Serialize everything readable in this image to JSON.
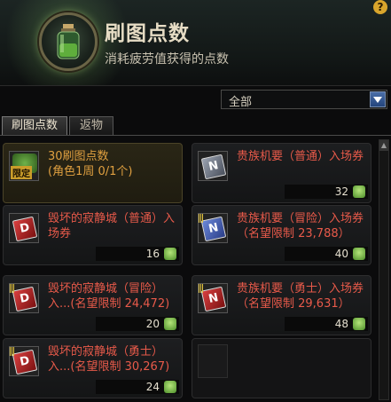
{
  "header": {
    "title": "刷图点数",
    "subtitle": "消耗疲劳值获得的点数",
    "help": "?"
  },
  "filter": {
    "value": "全部"
  },
  "tabs": [
    {
      "label": "刷图点数",
      "active": true
    },
    {
      "label": "返物",
      "active": false
    }
  ],
  "items": [
    {
      "name": "30刷图点数\n(角色1周 0/1个)",
      "badge": "限定",
      "qty": ""
    },
    {
      "name": "贵族机要（普通）入场券",
      "qty": "32"
    },
    {
      "name": "毁坏的寂静城（普通）入场券",
      "qty": "16"
    },
    {
      "name": "贵族机要（冒险）入场券（名望限制 23,788）",
      "qty": "40"
    },
    {
      "name": "毁坏的寂静城（冒险）入...(名望限制 24,472)",
      "qty": "20"
    },
    {
      "name": "贵族机要（勇士）入场券（名望限制 29,631）",
      "qty": "48"
    },
    {
      "name": "毁坏的寂静城（勇士）入...(名望限制 30,267)",
      "qty": "24"
    }
  ],
  "icons": {
    "header": "potion-icon",
    "filter_button": "dropdown-arrow-icon",
    "currency": "coin-icon"
  }
}
